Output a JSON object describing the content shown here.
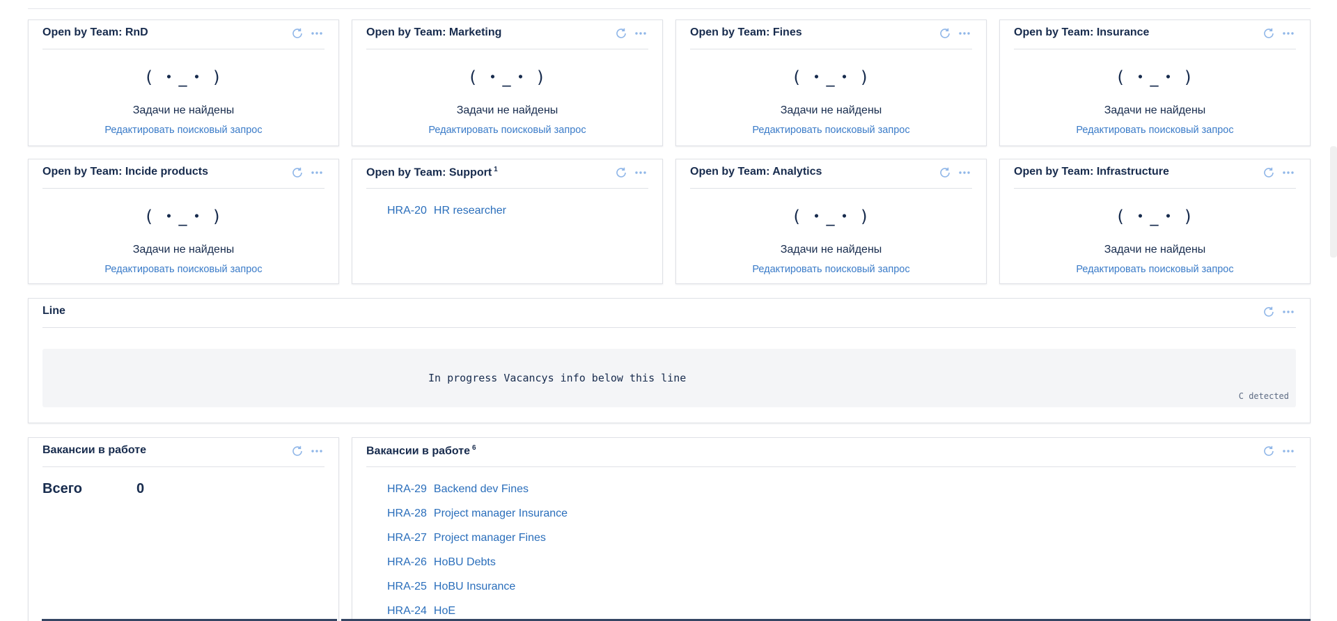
{
  "empty_state": {
    "face": "( ・_・ )",
    "message": "Задачи не найдены",
    "edit_link": "Редактировать поисковый запрос"
  },
  "widgets_row1": [
    {
      "title": "Open by Team: RnD"
    },
    {
      "title": "Open by Team: Marketing"
    },
    {
      "title": "Open by Team: Fines"
    },
    {
      "title": "Open by Team: Insurance"
    }
  ],
  "widgets_row2": [
    {
      "title": "Open by Team: Incide products"
    },
    {
      "title": "Open by Team: Support",
      "count": "1",
      "issues": [
        {
          "key": "HRA-20",
          "summary": "HR researcher"
        }
      ]
    },
    {
      "title": "Open by Team: Analytics"
    },
    {
      "title": "Open by Team: Infrastructure"
    }
  ],
  "line_widget": {
    "title": "Line",
    "code": "In progress Vacancys info below this line",
    "language": "C detected"
  },
  "vacancies_stats": {
    "title": "Вакансии в работе",
    "label": "Всего",
    "value": "0"
  },
  "vacancies_list": {
    "title": "Вакансии в работе",
    "count": "6",
    "issues": [
      {
        "key": "HRA-29",
        "summary": "Backend dev Fines"
      },
      {
        "key": "HRA-28",
        "summary": "Project manager Insurance"
      },
      {
        "key": "HRA-27",
        "summary": "Project manager Fines"
      },
      {
        "key": "HRA-26",
        "summary": "HoBU Debts"
      },
      {
        "key": "HRA-25",
        "summary": "HoBU Insurance"
      },
      {
        "key": "HRA-24",
        "summary": "HoE"
      }
    ]
  },
  "icons": {
    "refresh": "refresh-icon",
    "more": "more-icon"
  },
  "colors": {
    "link": "#2a6ebb",
    "light_link": "#3a7bc8",
    "icon": "#8fb6e8",
    "border": "#dfe1e6"
  }
}
